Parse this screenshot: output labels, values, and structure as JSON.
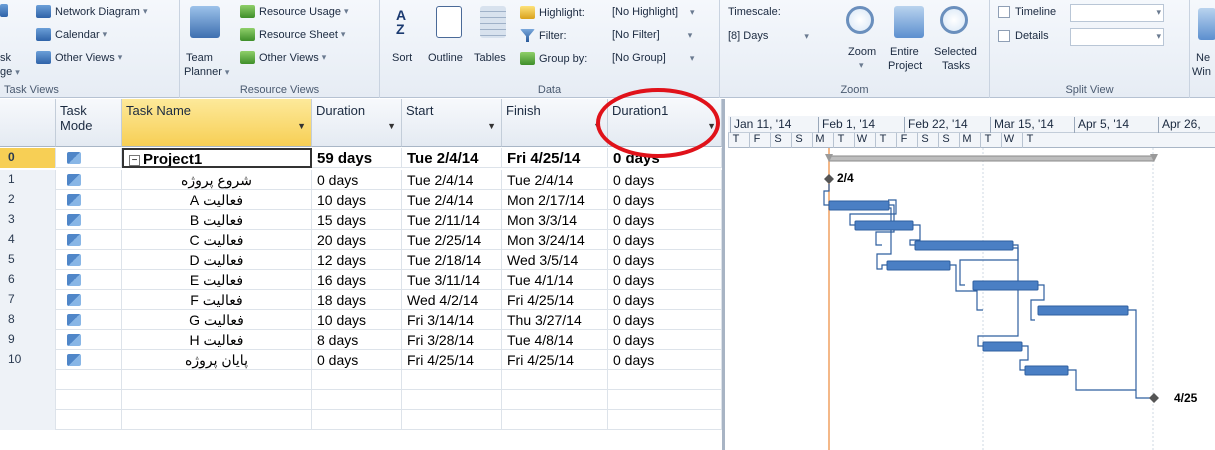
{
  "ribbon": {
    "task_views": {
      "network_diagram": "Network Diagram",
      "calendar": "Calendar",
      "other_views": "Other Views",
      "left_cut_1": "sk",
      "left_cut_2": "ge",
      "label": "Task Views"
    },
    "resource_views": {
      "team_planner_1": "Team",
      "team_planner_2": "Planner",
      "resource_usage": "Resource Usage",
      "resource_sheet": "Resource Sheet",
      "other_views": "Other Views",
      "label": "Resource Views"
    },
    "data": {
      "sort": "Sort",
      "outline": "Outline",
      "tables": "Tables",
      "highlight_label": "Highlight:",
      "highlight_value": "[No Highlight]",
      "filter_label": "Filter:",
      "filter_value": "[No Filter]",
      "group_label": "Group by:",
      "group_value": "[No Group]",
      "label": "Data"
    },
    "zoom": {
      "timescale_label": "Timescale:",
      "timescale_value": "[8] Days",
      "zoom": "Zoom",
      "entire_1": "Entire",
      "entire_2": "Project",
      "selected_1": "Selected",
      "selected_2": "Tasks",
      "label": "Zoom"
    },
    "split_view": {
      "timeline": "Timeline",
      "details": "Details",
      "label": "Split View"
    },
    "window": {
      "new_1": "Ne",
      "new_2": "Win"
    }
  },
  "columns": {
    "task_mode": [
      "Task",
      "Mode"
    ],
    "task_name": "Task Name",
    "duration": "Duration",
    "start": "Start",
    "finish": "Finish",
    "duration1": "Duration1"
  },
  "rows": [
    {
      "id": "0",
      "name": "Project1",
      "duration": "59 days",
      "start": "Tue 2/4/14",
      "finish": "Fri 4/25/14",
      "duration1": "0 days"
    },
    {
      "id": "1",
      "name": "شروع پروژه",
      "duration": "0 days",
      "start": "Tue 2/4/14",
      "finish": "Tue 2/4/14",
      "duration1": "0 days"
    },
    {
      "id": "2",
      "name": "فعالیت A",
      "duration": "10 days",
      "start": "Tue 2/4/14",
      "finish": "Mon 2/17/14",
      "duration1": "0 days"
    },
    {
      "id": "3",
      "name": "فعالیت B",
      "duration": "15 days",
      "start": "Tue 2/11/14",
      "finish": "Mon 3/3/14",
      "duration1": "0 days"
    },
    {
      "id": "4",
      "name": "فعالیت C",
      "duration": "20 days",
      "start": "Tue 2/25/14",
      "finish": "Mon 3/24/14",
      "duration1": "0 days"
    },
    {
      "id": "5",
      "name": "فعالیت D",
      "duration": "12 days",
      "start": "Tue 2/18/14",
      "finish": "Wed 3/5/14",
      "duration1": "0 days"
    },
    {
      "id": "6",
      "name": "فعالیت E",
      "duration": "16 days",
      "start": "Tue 3/11/14",
      "finish": "Tue 4/1/14",
      "duration1": "0 days"
    },
    {
      "id": "7",
      "name": "فعالیت F",
      "duration": "18 days",
      "start": "Wed 4/2/14",
      "finish": "Fri 4/25/14",
      "duration1": "0 days"
    },
    {
      "id": "8",
      "name": "فعالیت G",
      "duration": "10 days",
      "start": "Fri 3/14/14",
      "finish": "Thu 3/27/14",
      "duration1": "0 days"
    },
    {
      "id": "9",
      "name": "فعالیت H",
      "duration": "8 days",
      "start": "Fri 3/28/14",
      "finish": "Tue 4/8/14",
      "duration1": "0 days"
    },
    {
      "id": "10",
      "name": "پایان پروژه",
      "duration": "0 days",
      "start": "Fri 4/25/14",
      "finish": "Fri 4/25/14",
      "duration1": "0 days"
    }
  ],
  "gantt": {
    "weeks": [
      "Jan 11, '14",
      "Feb 1, '14",
      "Feb 22, '14",
      "Mar 15, '14",
      "Apr 5, '14",
      "Apr 26,"
    ],
    "days": [
      "T",
      "F",
      "S",
      "S",
      "M",
      "T",
      "W",
      "T",
      "F",
      "S",
      "S",
      "M",
      "T",
      "W",
      "T"
    ],
    "milestone_start_label": "2/4",
    "milestone_end_label": "4/25",
    "colors": {
      "bar": "#4a7fc4",
      "summary": "#9a9a9a",
      "today_line": "#f0a060",
      "link": "#2f5f9f"
    }
  }
}
